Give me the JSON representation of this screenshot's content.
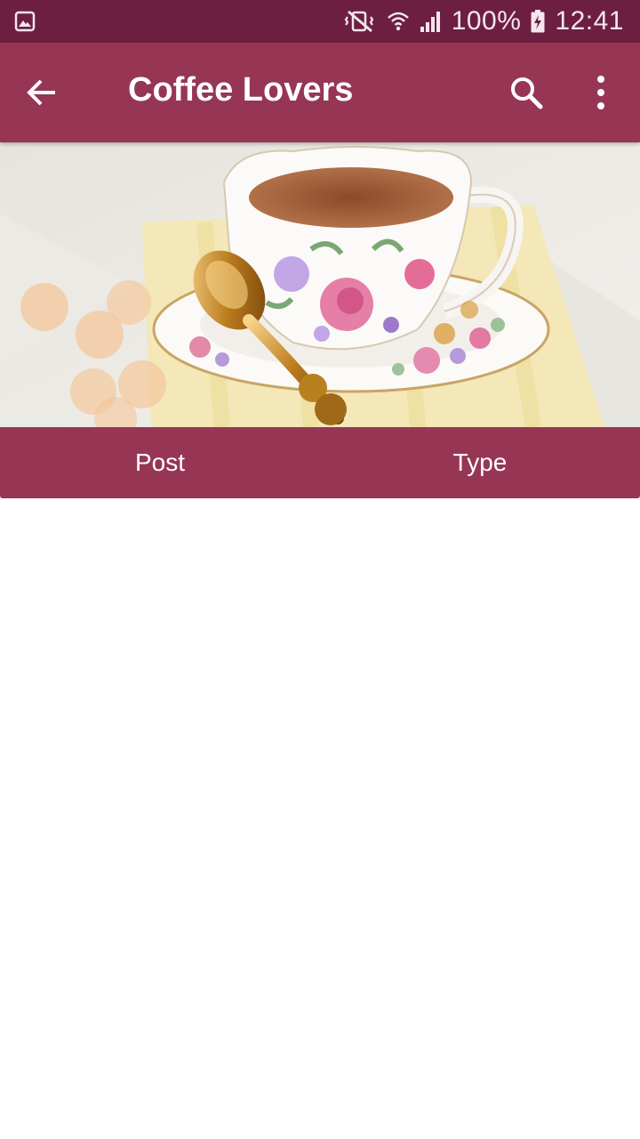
{
  "status_bar": {
    "icons": [
      "gallery-icon",
      "mute-vibrate-icon",
      "wifi-icon",
      "signal-icon",
      "battery-charging-icon"
    ],
    "battery": "100%",
    "time": "12:41"
  },
  "app_bar": {
    "title": "Coffee Lovers",
    "icons": [
      "back-arrow-icon",
      "search-icon",
      "more-vert-icon"
    ]
  },
  "tabs": [
    {
      "label": "Post"
    },
    {
      "label": "Type"
    }
  ],
  "colors": {
    "status_bar": "#6d1f42",
    "primary": "#963654",
    "background": "#ffffff",
    "on_primary": "#ffffff"
  }
}
